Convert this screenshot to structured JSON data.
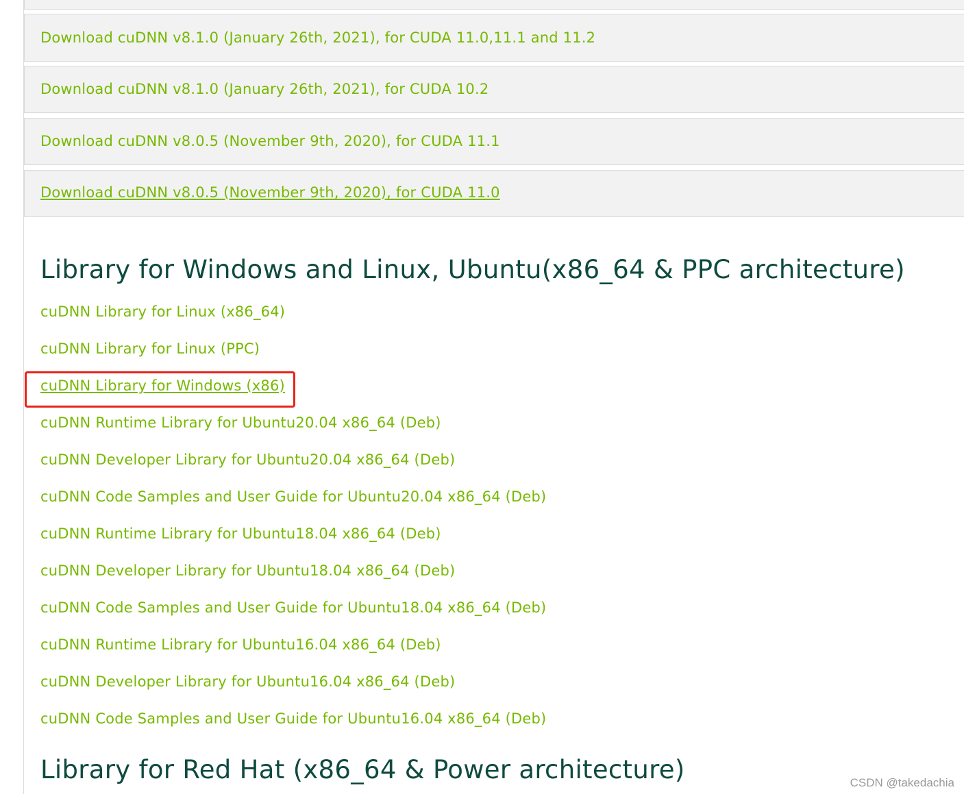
{
  "downloads": [
    {
      "label": "Download cuDNN v8.1.0 (January 26th, 2021), for CUDA 11.0,11.1 and 11.2"
    },
    {
      "label": "Download cuDNN v8.1.0 (January 26th, 2021), for CUDA 10.2"
    },
    {
      "label": "Download cuDNN v8.0.5 (November 9th, 2020), for CUDA 11.1"
    },
    {
      "label": "Download cuDNN v8.0.5 (November 9th, 2020), for CUDA 11.0"
    }
  ],
  "sections": [
    {
      "heading": "Library for Windows and Linux, Ubuntu(x86_64 & PPC architecture)",
      "links": [
        "cuDNN Library for Linux (x86_64)",
        "cuDNN Library for Linux (PPC)",
        "cuDNN Library for Windows (x86)",
        "cuDNN Runtime Library for Ubuntu20.04 x86_64 (Deb)",
        "cuDNN Developer Library for Ubuntu20.04 x86_64 (Deb)",
        "cuDNN Code Samples and User Guide for Ubuntu20.04 x86_64 (Deb)",
        "cuDNN Runtime Library for Ubuntu18.04 x86_64 (Deb)",
        "cuDNN Developer Library for Ubuntu18.04 x86_64 (Deb)",
        "cuDNN Code Samples and User Guide for Ubuntu18.04 x86_64 (Deb)",
        "cuDNN Runtime Library for Ubuntu16.04 x86_64 (Deb)",
        "cuDNN Developer Library for Ubuntu16.04 x86_64 (Deb)",
        "cuDNN Code Samples and User Guide for Ubuntu16.04 x86_64 (Deb)"
      ]
    },
    {
      "heading": "Library for Red Hat (x86_64 & Power architecture)",
      "links": []
    }
  ],
  "watermark": "CSDN @takedachia",
  "colors": {
    "link_green": "#76b900",
    "heading_teal": "#0f4a3f",
    "highlight_red": "#e8231a",
    "bar_background": "#f2f2f2"
  }
}
